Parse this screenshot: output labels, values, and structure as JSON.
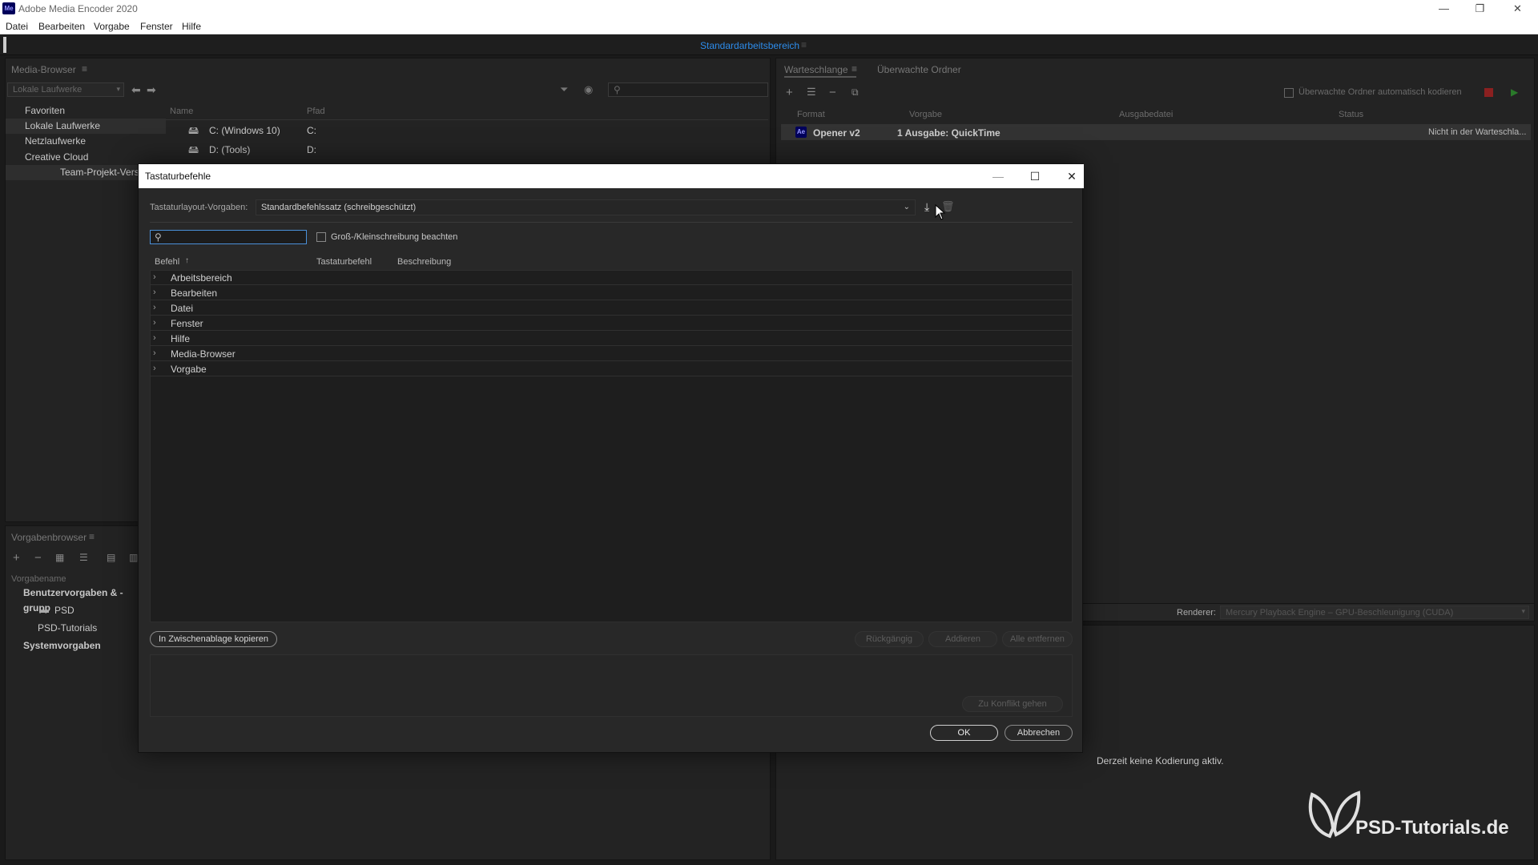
{
  "app": {
    "logo": "Me",
    "title": "Adobe Media Encoder 2020"
  },
  "window_controls": {
    "minimize": "—",
    "restore": "❐",
    "close": "✕"
  },
  "menu": [
    "Datei",
    "Bearbeiten",
    "Vorgabe",
    "Fenster",
    "Hilfe"
  ],
  "workspace": {
    "label": "Standardarbeitsbereich",
    "menu_icon": "≡"
  },
  "media_browser": {
    "title": "Media-Browser",
    "location_dropdown": "Lokale Laufwerke",
    "tree": [
      "Favoriten",
      "Lokale Laufwerke",
      "Netzlaufwerke",
      "Creative Cloud",
      "Team-Projekt-Vers"
    ],
    "columns": {
      "name": "Name",
      "path": "Pfad"
    },
    "drives": [
      {
        "name": "C: (Windows 10)",
        "path": "C:"
      },
      {
        "name": "D: (Tools)",
        "path": "D:"
      }
    ]
  },
  "preset_browser": {
    "title": "Vorgabenbrowser",
    "column": "Vorgabename",
    "tree": [
      "Benutzervorgaben & -grupp",
      "PSD",
      "PSD-Tutorials",
      "Systemvorgaben"
    ]
  },
  "queue": {
    "tabs": [
      "Warteschlange",
      "Überwachte Ordner"
    ],
    "auto_encode_label": "Überwachte Ordner automatisch kodieren",
    "columns": {
      "format": "Format",
      "preset": "Vorgabe",
      "output": "Ausgabedatei",
      "status": "Status"
    },
    "item": {
      "badge": "Ae",
      "name": "Opener v2",
      "preset": "1 Ausgabe: QuickTime",
      "status": "Nicht in der Warteschla..."
    },
    "renderer_label": "Renderer:",
    "renderer_value": "Mercury Playback Engine – GPU-Beschleunigung (CUDA)"
  },
  "encoding_status": "Derzeit keine Kodierung aktiv.",
  "watermark": {
    "text": "PSD-Tutorials.de"
  },
  "dialog": {
    "title": "Tastaturbefehle",
    "layout_label": "Tastaturlayout-Vorgaben:",
    "layout_value": "Standardbefehlssatz (schreibgeschützt)",
    "search_placeholder": "",
    "case_label": "Groß-/Kleinschreibung beachten",
    "columns": {
      "command": "Befehl",
      "shortcut": "Tastaturbefehl",
      "description": "Beschreibung"
    },
    "commands": [
      "Arbeitsbereich",
      "Bearbeiten",
      "Datei",
      "Fenster",
      "Hilfe",
      "Media-Browser",
      "Vorgabe"
    ],
    "copy_button": "In Zwischenablage kopieren",
    "undo_button": "Rückgängig",
    "add_button": "Addieren",
    "remove_all_button": "Alle entfernen",
    "goto_conflict_button": "Zu Konflikt gehen",
    "ok_button": "OK",
    "cancel_button": "Abbrechen"
  },
  "colors": {
    "accent": "#2d8ceb",
    "dialog_bg": "#282828",
    "panel_bg": "#232323"
  }
}
